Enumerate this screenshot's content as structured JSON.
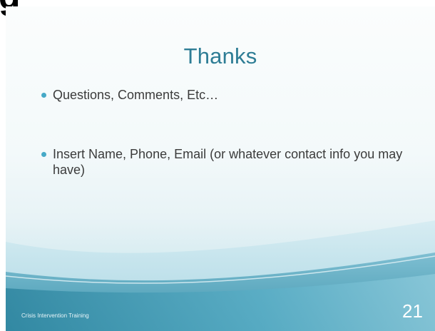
{
  "page": {
    "edge_glyph": "g"
  },
  "slide": {
    "title": "Thanks",
    "bullets": [
      "Questions, Comments, Etc…",
      "Insert Name, Phone, Email (or whatever contact info you may have)"
    ],
    "footer": "Crisis Intervention  Training",
    "page_number": "21"
  },
  "colors": {
    "title": "#2e7d95",
    "bullet_dot": "#46a9c7",
    "wave_dark": "#3f95ae",
    "wave_light": "#9fd0de",
    "body_text": "#3b3b3b"
  }
}
